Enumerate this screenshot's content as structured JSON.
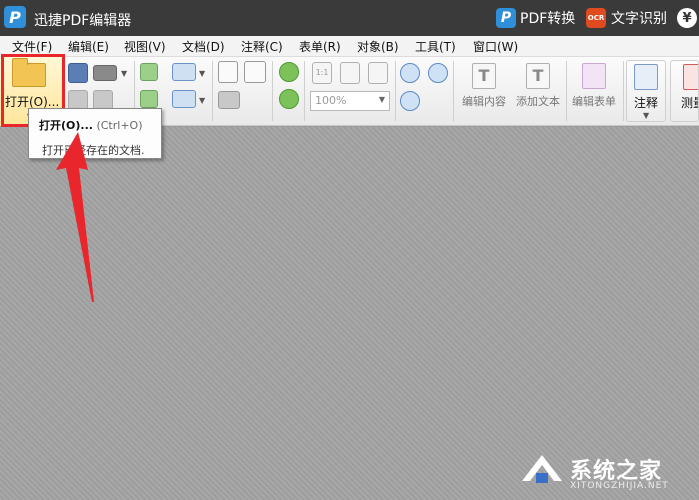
{
  "app": {
    "logo_letter": "P",
    "title": "迅捷PDF编辑器",
    "pdf_convert_label": "PDF转换",
    "ocr_badge": "OCR",
    "ocr_label": "文字识别",
    "yen_symbol": "¥"
  },
  "menu": [
    {
      "label": "文件(F)"
    },
    {
      "label": "编辑(E)"
    },
    {
      "label": "视图(V)"
    },
    {
      "label": "文档(D)"
    },
    {
      "label": "注释(C)"
    },
    {
      "label": "表单(R)"
    },
    {
      "label": "对象(B)"
    },
    {
      "label": "工具(T)"
    },
    {
      "label": "窗口(W)"
    }
  ],
  "toolbar": {
    "open_label": "打开(O)...",
    "zoom_value": "100%",
    "edit_content_label": "编辑内容",
    "add_text_label": "添加文本",
    "edit_form_label": "编辑表单",
    "annotate_label": "注释",
    "measure_label": "测量"
  },
  "tooltip": {
    "title": "打开(O)...",
    "shortcut": "(Ctrl+O)",
    "description": "打开已经存在的文档."
  },
  "watermark": {
    "text": "系统之家",
    "sub": "XITONGZHIJIA.NET"
  },
  "colors": {
    "titlebar": "#3a3a3a",
    "highlight_red": "#e8262b",
    "brand_blue": "#2f8fd8",
    "ocr_orange": "#e04a1f"
  }
}
